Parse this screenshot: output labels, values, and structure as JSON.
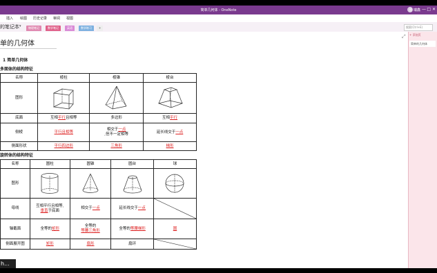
{
  "window": {
    "title": "简单几何体 - OneNote",
    "user": "张 瑞鑫",
    "controls": [
      "—",
      "□",
      "✕"
    ]
  },
  "ribbon": {
    "tabs": [
      "插入",
      "绘图",
      "历史记录",
      "审阅",
      "视图"
    ]
  },
  "notebook": {
    "name": "的笔记本",
    "sections": [
      {
        "label": "物理笔记",
        "color": "#e088b0"
      },
      {
        "label": "数学笔记",
        "color": "#e0608a"
      },
      {
        "label": "英语",
        "color": "#d98ad6"
      },
      {
        "label": "数学练习",
        "color": "#7db0e0"
      },
      {
        "label": "+",
        "color": "#eee"
      }
    ],
    "search_placeholder": "搜索(Ctrl+E)"
  },
  "side": {
    "add_page": "+ 添加页",
    "pages": [
      "简单的几何体"
    ]
  },
  "page": {
    "title": "单的几何体",
    "heading1": "1 简单几何体",
    "heading_poly": "多面体的结构特征",
    "heading_rot": "旋转体的结构特征"
  },
  "poly_table": {
    "headers": [
      "名称",
      "棱柱",
      "棱锥",
      "棱台"
    ],
    "row_labels": [
      "图形",
      "底面",
      "侧棱",
      "侧面形状"
    ],
    "rows": {
      "base": [
        [
          "互相",
          "平行",
          "且相等"
        ],
        [
          "多边形"
        ],
        [
          "互相",
          "平行"
        ]
      ],
      "edge": [
        [
          "平行且相等"
        ],
        [
          "相交于",
          "一点",
          ",但不一定相等"
        ],
        [
          "延长线交于",
          "一点"
        ]
      ],
      "face": [
        [
          "平行四边形"
        ],
        [
          "三角形"
        ],
        [
          "梯形"
        ]
      ]
    }
  },
  "rot_table": {
    "headers": [
      "名称",
      "圆柱",
      "圆锥",
      "圆台",
      "球"
    ],
    "row_labels": [
      "图形",
      "母线",
      "轴截面",
      "侧面展开图"
    ],
    "busbar": [
      [
        "互相平行且相等,",
        "垂直",
        "于底面"
      ],
      [
        "相交于",
        "一点"
      ],
      [
        "延长线交于",
        "一点"
      ]
    ],
    "axis": [
      [
        "全等的",
        "矩形"
      ],
      [
        "全等的",
        "等腰三角形"
      ],
      [
        "全等的",
        "等腰梯形"
      ],
      [
        "圆"
      ]
    ],
    "unfold": [
      [
        "矩形"
      ],
      [
        "扇形"
      ],
      [
        "扇环"
      ]
    ]
  },
  "caption": "h..."
}
